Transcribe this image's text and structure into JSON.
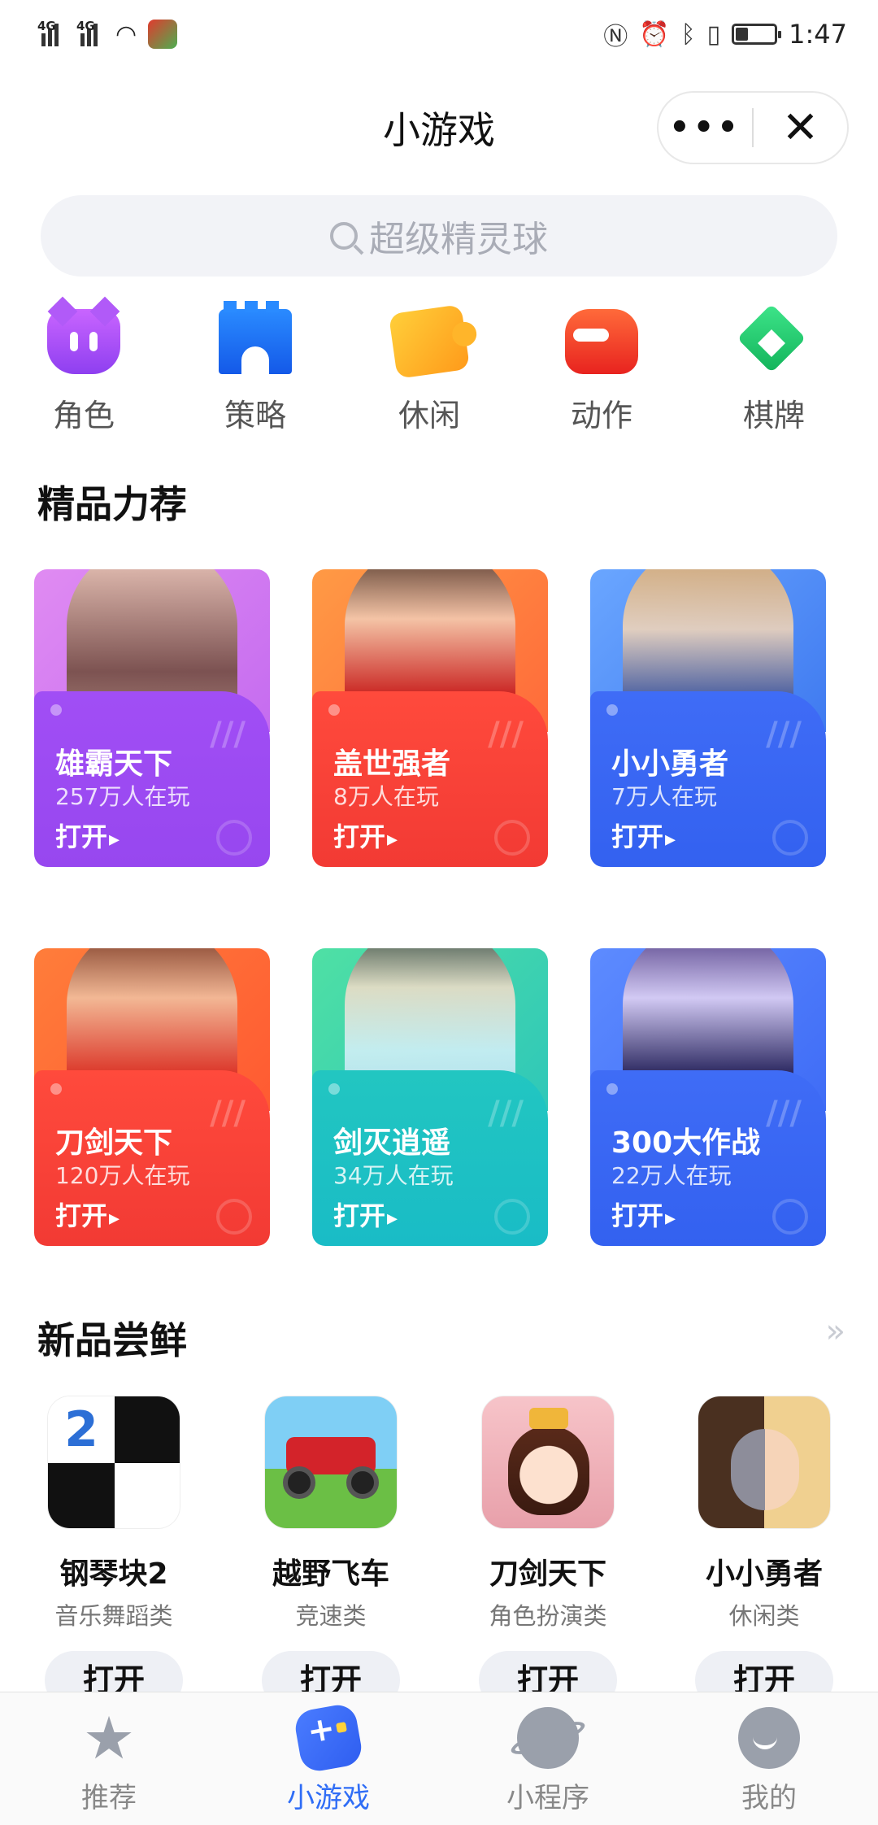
{
  "status_bar": {
    "network_1": "4G",
    "network_2": "4G",
    "time": "1:47"
  },
  "header": {
    "title": "小游戏",
    "more_label": "•••",
    "close_label": "✕"
  },
  "search": {
    "placeholder": "超级精灵球"
  },
  "categories": [
    {
      "label": "角色",
      "icon": "demon-mask-icon"
    },
    {
      "label": "策略",
      "icon": "castle-tower-icon"
    },
    {
      "label": "休闲",
      "icon": "puzzle-piece-icon"
    },
    {
      "label": "动作",
      "icon": "boxing-glove-icon"
    },
    {
      "label": "棋牌",
      "icon": "spade-card-icon"
    }
  ],
  "featured": {
    "title": "精品力荐",
    "items": [
      {
        "name": "雄霸天下",
        "players": "257万人在玩",
        "action": "打开"
      },
      {
        "name": "盖世强者",
        "players": "8万人在玩",
        "action": "打开"
      },
      {
        "name": "小小勇者",
        "players": "7万人在玩",
        "action": "打开"
      },
      {
        "name": "刀剑天下",
        "players": "120万人在玩",
        "action": "打开"
      },
      {
        "name": "剑灭逍遥",
        "players": "34万人在玩",
        "action": "打开"
      },
      {
        "name": "300大作战",
        "players": "22万人在玩",
        "action": "打开"
      }
    ]
  },
  "new_games": {
    "title": "新品尝鲜",
    "more_icon": "double-chevron-right-icon",
    "items": [
      {
        "name": "钢琴块2",
        "category": "音乐舞蹈类",
        "action": "打开",
        "thumb_text": "2"
      },
      {
        "name": "越野飞车",
        "category": "竞速类",
        "action": "打开"
      },
      {
        "name": "刀剑天下",
        "category": "角色扮演类",
        "action": "打开"
      },
      {
        "name": "小小勇者",
        "category": "休闲类",
        "action": "打开"
      }
    ]
  },
  "tabbar": {
    "active_color": "#2f6df6",
    "tabs": [
      {
        "label": "推荐",
        "icon": "star-icon"
      },
      {
        "label": "小游戏",
        "icon": "gamepad-icon",
        "active": true
      },
      {
        "label": "小程序",
        "icon": "planet-icon"
      },
      {
        "label": "我的",
        "icon": "smile-face-icon"
      }
    ]
  }
}
